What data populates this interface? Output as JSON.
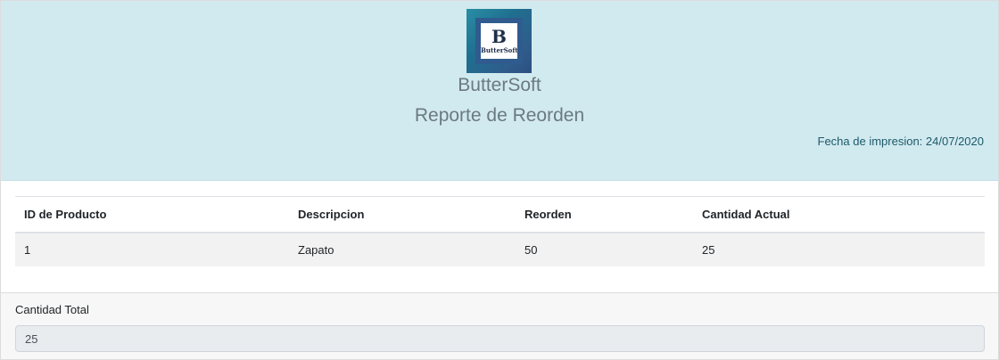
{
  "logo": {
    "letter": "B",
    "name": "ButterSoft"
  },
  "header": {
    "company": "ButterSoft",
    "title": "Reporte de Reorden",
    "print_date_label": "Fecha de impresion:",
    "print_date_value": "24/07/2020"
  },
  "table": {
    "columns": [
      "ID de Producto",
      "Descripcion",
      "Reorden",
      "Cantidad Actual"
    ],
    "rows": [
      [
        "1",
        "Zapato",
        "50",
        "25"
      ]
    ]
  },
  "footer": {
    "total_label": "Cantidad Total",
    "total_value": "25"
  },
  "colors": {
    "header_bg": "#d1eaf0",
    "row_bg": "#f2f2f2",
    "date_text": "#1d5968"
  }
}
